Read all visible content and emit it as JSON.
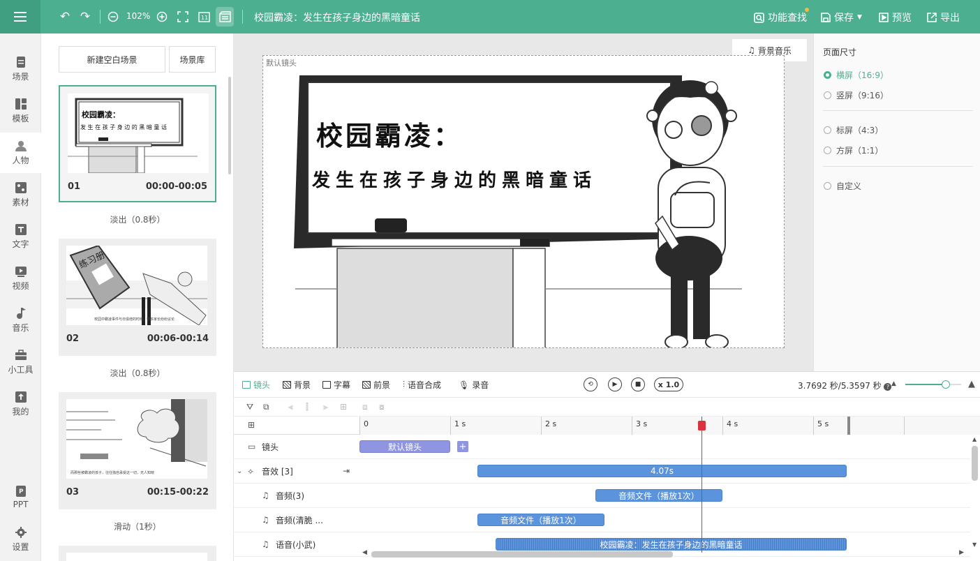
{
  "topbar": {
    "zoom": "102%",
    "title": "校园霸凌：发生在孩子身边的黑暗童话",
    "search_label": "功能查找",
    "save_label": "保存",
    "preview_label": "预览",
    "export_label": "导出"
  },
  "leftnav": {
    "items": [
      {
        "label": "场景"
      },
      {
        "label": "模板"
      },
      {
        "label": "人物"
      },
      {
        "label": "素材"
      },
      {
        "label": "文字"
      },
      {
        "label": "视频"
      },
      {
        "label": "音乐"
      },
      {
        "label": "小工具"
      },
      {
        "label": "我的"
      },
      {
        "label": "PPT"
      },
      {
        "label": "设置"
      }
    ]
  },
  "scenes": {
    "new_blank_label": "新建空白场景",
    "library_label": "场景库",
    "cards": [
      {
        "num": "01",
        "time": "00:00-00:05",
        "transition": "淡出（0.8秒）"
      },
      {
        "num": "02",
        "time": "00:06-00:14",
        "transition": "淡出（0.8秒）"
      },
      {
        "num": "03",
        "time": "00:15-00:22",
        "transition": "滑动（1秒）"
      }
    ]
  },
  "canvas": {
    "camera_label": "默认镜头",
    "bgm_label": "背景音乐",
    "board_title": "校园霸凌：",
    "board_subtitle": "发生在孩子身边的黑暗童话"
  },
  "rightpanel": {
    "title": "页面尺寸",
    "options": [
      {
        "label": "横屏（16:9）",
        "selected": true
      },
      {
        "label": "竖屏（9:16）",
        "selected": false
      },
      {
        "label": "标屏（4:3）",
        "selected": false
      },
      {
        "label": "方屏（1:1）",
        "selected": false
      },
      {
        "label": "自定义",
        "selected": false
      }
    ]
  },
  "timeline": {
    "tabs": [
      {
        "label": "镜头"
      },
      {
        "label": "背景"
      },
      {
        "label": "字幕"
      },
      {
        "label": "前景"
      },
      {
        "label": "语音合成"
      },
      {
        "label": "录音"
      }
    ],
    "speed": "x 1.0",
    "time_readout": "3.7692 秒/5.3597 秒",
    "zoom_level": 0.72,
    "ruler": [
      "0",
      "1 s",
      "2 s",
      "3 s",
      "4 s",
      "5 s"
    ],
    "playhead_seconds": 3.7692,
    "tracks": [
      {
        "label": "镜头",
        "clips": [
          {
            "text": "默认镜头",
            "start": 0,
            "end": 1.0,
            "kind": "purple"
          }
        ]
      },
      {
        "label": "音效 [3]",
        "clips": [
          {
            "text": "4.07s",
            "start": 1.3,
            "end": 5.37,
            "kind": "blue"
          }
        ]
      },
      {
        "label": "音频(3)",
        "clips": [
          {
            "text": "音频文件（播放1次）",
            "start": 2.6,
            "end": 4.0,
            "kind": "blue"
          }
        ]
      },
      {
        "label": "音频(清脆 ...",
        "clips": [
          {
            "text": "音频文件（播放1次）",
            "start": 1.3,
            "end": 2.7,
            "kind": "blue"
          }
        ]
      },
      {
        "label": "语音(小武)",
        "clips": [
          {
            "text": "校园霸凌：发生在孩子身边的黑暗童话",
            "start": 1.5,
            "end": 5.37,
            "kind": "blue"
          }
        ]
      }
    ]
  },
  "colors": {
    "accent": "#4caf8f",
    "clip_purple": "#8f95e0",
    "clip_blue": "#5b93dd",
    "playhead": "#d9333f"
  }
}
